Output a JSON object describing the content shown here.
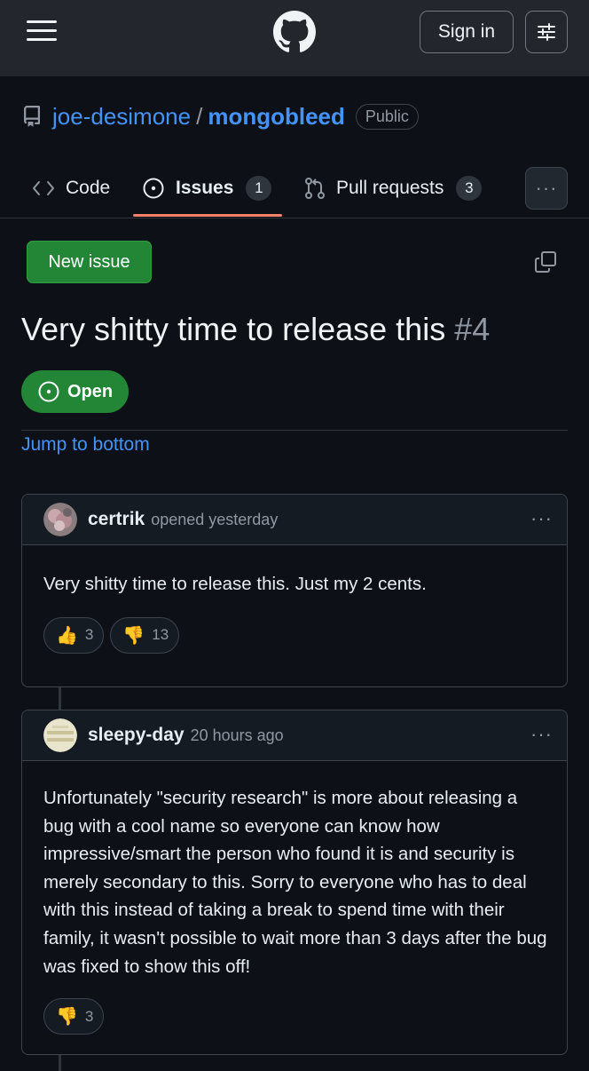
{
  "header": {
    "sign_in_label": "Sign in"
  },
  "repo": {
    "owner": "joe-desimone",
    "separator": "/",
    "name": "mongobleed",
    "visibility": "Public"
  },
  "tabs": [
    {
      "label": "Code"
    },
    {
      "label": "Issues",
      "count": "1"
    },
    {
      "label": "Pull requests",
      "count": "3"
    }
  ],
  "more_label": "···",
  "issue": {
    "new_issue_label": "New issue",
    "title": "Very shitty time to release this",
    "number": "#4",
    "state": "Open",
    "jump_label": "Jump to bottom"
  },
  "comments": [
    {
      "author": "certrik",
      "meta": "opened yesterday",
      "body": "Very shitty time to release this. Just my 2 cents.",
      "reactions": [
        {
          "emoji": "👍",
          "count": "3"
        },
        {
          "emoji": "👎",
          "count": "13"
        }
      ]
    },
    {
      "author": "sleepy-day",
      "meta": "20 hours ago",
      "body": "Unfortunately \"security research\" is more about releasing a bug with a cool name so everyone can know how impressive/smart the person who found it is and security is merely secondary to this. Sorry to everyone who has to deal with this instead of taking a break to spend time with their family, it wasn't possible to wait more than 3 days after the bug was fixed to show this off!",
      "reactions": [
        {
          "emoji": "👎",
          "count": "3"
        }
      ]
    }
  ],
  "colors": {
    "background": "#0d1117",
    "header_bg": "#23262c",
    "link": "#4493f8",
    "accent_green": "#238636",
    "tab_underline": "#f78166",
    "muted": "#9198a1"
  },
  "icons": [
    "menu-icon",
    "github-logo-icon",
    "tune-icon",
    "repo-icon",
    "code-icon",
    "issue-open-icon",
    "pull-request-icon",
    "copy-icon",
    "kebab-icon"
  ]
}
